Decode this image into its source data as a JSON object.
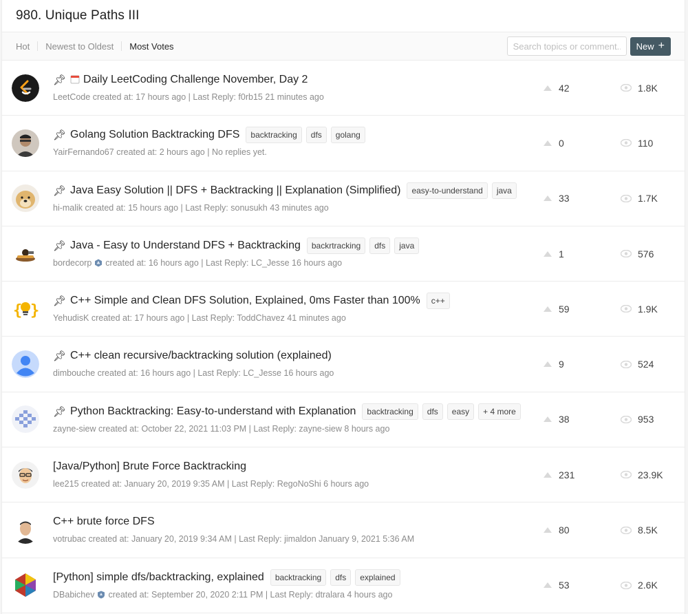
{
  "header": {
    "title": "980. Unique Paths III"
  },
  "toolbar": {
    "tabs": [
      {
        "label": "Hot"
      },
      {
        "label": "Newest to Oldest"
      },
      {
        "label": "Most Votes"
      }
    ],
    "search_placeholder": "Search topics or comment...",
    "new_label": "New"
  },
  "posts": [
    {
      "title": "Daily LeetCoding Challenge November, Day 2",
      "author": "LeetCode",
      "meta": "created at: 17 hours ago | Last Reply: f0rb15 21 minutes ago",
      "votes": "42",
      "views": "1.8K",
      "tags": []
    },
    {
      "title": "Golang Solution Backtracking DFS",
      "author": "YairFernando67",
      "meta": "created at: 2 hours ago | No replies yet.",
      "votes": "0",
      "views": "110",
      "tags": [
        "backtracking",
        "dfs",
        "golang"
      ]
    },
    {
      "title": "Java Easy Solution || DFS + Backtracking || Explanation (Simplified)",
      "author": "hi-malik",
      "meta": "created at: 15 hours ago | Last Reply: sonusukh 43 minutes ago",
      "votes": "33",
      "views": "1.7K",
      "tags": [
        "easy-to-understand",
        "java"
      ]
    },
    {
      "title": "Java - Easy to Understand DFS + Backtracking",
      "author": "bordecorp",
      "meta": "created at: 16 hours ago | Last Reply: LC_Jesse 16 hours ago",
      "votes": "1",
      "views": "576",
      "tags": [
        "backrtracking",
        "dfs",
        "java"
      ]
    },
    {
      "title": "C++ Simple and Clean DFS Solution, Explained, 0ms Faster than 100%",
      "author": "YehudisK",
      "meta": "created at: 17 hours ago | Last Reply: ToddChavez 41 minutes ago",
      "votes": "59",
      "views": "1.9K",
      "tags": [
        "c++"
      ]
    },
    {
      "title": "C++ clean recursive/backtracking solution (explained)",
      "author": "dimbouche",
      "meta": "created at: 16 hours ago | Last Reply: LC_Jesse 16 hours ago",
      "votes": "9",
      "views": "524",
      "tags": []
    },
    {
      "title": "Python Backtracking: Easy-to-understand with Explanation",
      "author": "zayne-siew",
      "meta": "created at: October 22, 2021 11:03 PM | Last Reply: zayne-siew 8 hours ago",
      "votes": "38",
      "views": "953",
      "tags": [
        "backtracking",
        "dfs",
        "easy",
        "+ 4 more"
      ]
    },
    {
      "title": "[Java/Python] Brute Force Backtracking",
      "author": "lee215",
      "meta": "created at: January 20, 2019 9:35 AM | Last Reply: RegoNoShi 6 hours ago",
      "votes": "231",
      "views": "23.9K",
      "tags": []
    },
    {
      "title": "C++ brute force DFS",
      "author": "votrubac",
      "meta": "created at: January 20, 2019 9:34 AM | Last Reply: jimaldon January 9, 2021 5:36 AM",
      "votes": "80",
      "views": "8.5K",
      "tags": []
    },
    {
      "title": "[Python] simple dfs/backtracking, explained",
      "author": "DBabichev",
      "meta": "created at: September 20, 2020 2:11 PM | Last Reply: dtralara 4 hours ago",
      "votes": "53",
      "views": "2.6K",
      "tags": [
        "backtracking",
        "dfs",
        "explained"
      ]
    }
  ],
  "colors": {
    "new_button": "#455a64",
    "accent": "#ffa116"
  }
}
